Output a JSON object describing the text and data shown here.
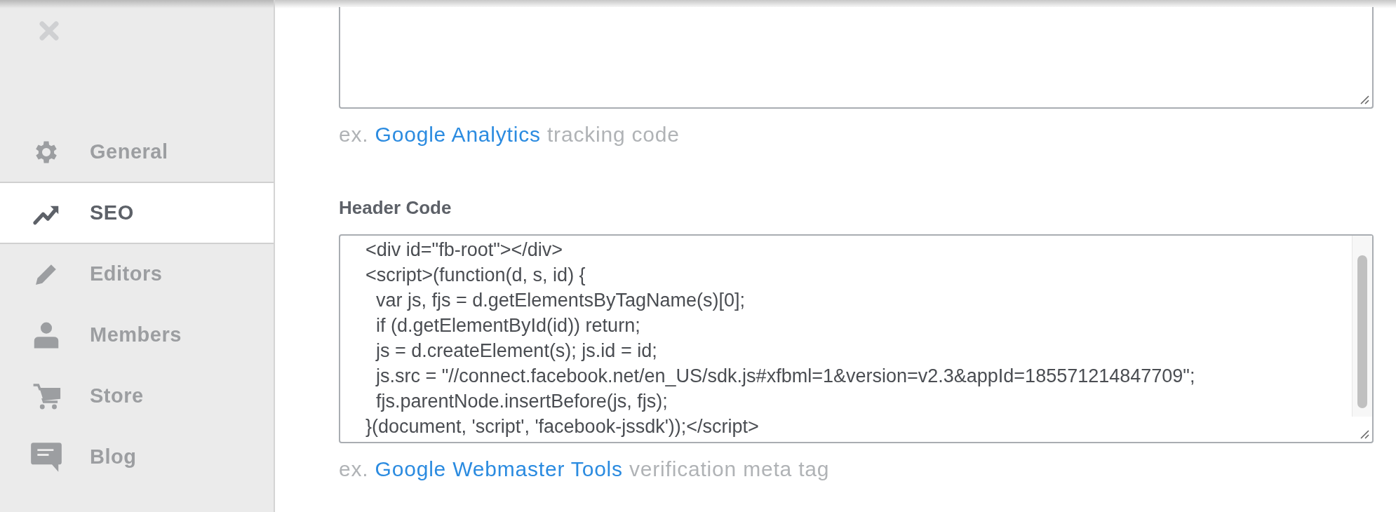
{
  "sidebar": {
    "items": [
      {
        "kind": "gear",
        "label": "General",
        "selected": false
      },
      {
        "kind": "trend",
        "label": "SEO",
        "selected": true
      },
      {
        "kind": "pencil",
        "label": "Editors",
        "selected": false
      },
      {
        "kind": "person",
        "label": "Members",
        "selected": false
      },
      {
        "kind": "cart",
        "label": "Store",
        "selected": false
      },
      {
        "kind": "chat",
        "label": "Blog",
        "selected": false
      }
    ]
  },
  "footer_code": {
    "hint": {
      "prefix": "ex.",
      "link": "Google Analytics",
      "suffix": "tracking code"
    }
  },
  "header_code": {
    "label": "Header Code",
    "value": [
      "<div id=\"fb-root\"></div>",
      "<script>(function(d, s, id) {",
      "  var js, fjs = d.getElementsByTagName(s)[0];",
      "  if (d.getElementById(id)) return;",
      "  js = d.createElement(s); js.id = id;",
      "  js.src = \"//connect.facebook.net/en_US/sdk.js#xfbml=1&version=v2.3&appId=185571214847709\";",
      "  fjs.parentNode.insertBefore(js, fjs);",
      "}(document, 'script', 'facebook-jssdk'));</script>"
    ],
    "hint": {
      "prefix": "ex.",
      "link": "Google Webmaster Tools",
      "suffix": "verification meta tag"
    }
  }
}
